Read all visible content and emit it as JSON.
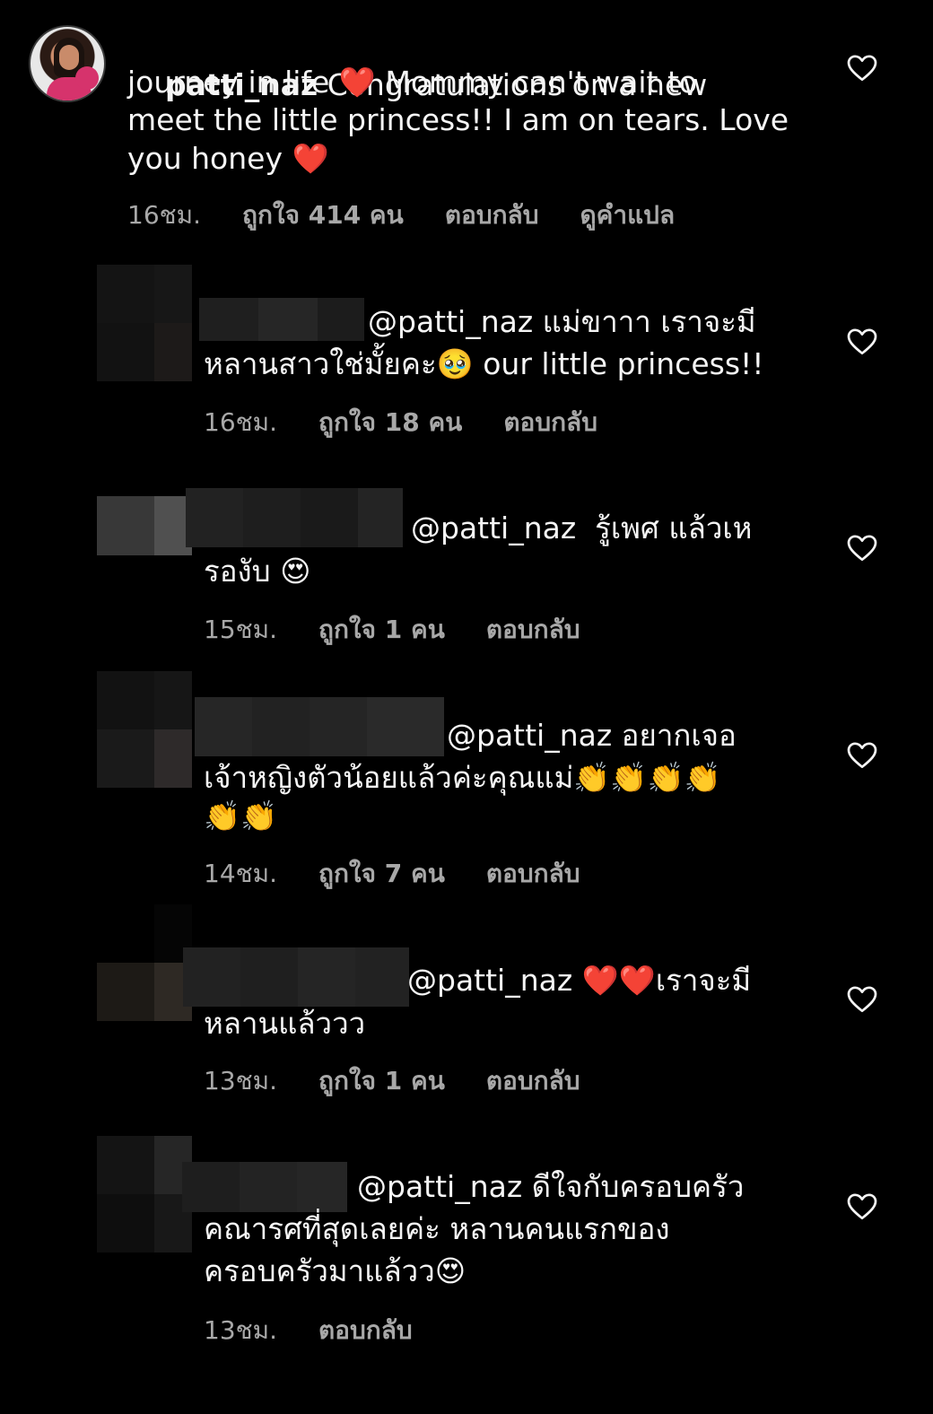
{
  "comments": [
    {
      "username": "patti_naz",
      "lines": [
        " Congratulations on a new",
        "journey in life ❤️ Mommy can't wait to",
        "meet the little princess!! I am on tears. Love",
        "you honey ❤️"
      ],
      "time": "16ชม.",
      "likes": "ถูกใจ 414 คน",
      "reply": "ตอบกลับ",
      "translate": "ดูคำแปล"
    },
    {
      "lines": [
        "@patti_naz แม่ขาาา เราจะมี",
        "หลานสาวใช่มั้ยคะ🥹 our little princess!!"
      ],
      "time": "16ชม.",
      "likes": "ถูกใจ 18 คน",
      "reply": "ตอบกลับ"
    },
    {
      "lines": [
        "@patti_naz  รู้เพศ แล้วเห",
        "รองับ 😍"
      ],
      "time": "15ชม.",
      "likes": "ถูกใจ 1 คน",
      "reply": "ตอบกลับ"
    },
    {
      "lines": [
        "@patti_naz อยากเจอ",
        "เจ้าหญิงตัวน้อยแล้วค่ะคุณแม่👏👏👏👏",
        "👏👏"
      ],
      "time": "14ชม.",
      "likes": "ถูกใจ 7 คน",
      "reply": "ตอบกลับ"
    },
    {
      "lines": [
        "@patti_naz ❤️❤️เราจะมี",
        "หลานแล้ววว"
      ],
      "time": "13ชม.",
      "likes": "ถูกใจ 1 คน",
      "reply": "ตอบกลับ"
    },
    {
      "lines": [
        "@patti_naz ดีใจกับครอบครัว",
        "คณารศที่สุดเลยค่ะ หลานคนแรกของ",
        "ครอบครัวมาแล้วว😍"
      ],
      "time": "13ชม.",
      "reply": "ตอบกลับ"
    }
  ],
  "icons": {
    "like": "heart-outline-icon"
  },
  "colors": {
    "background": "#000000",
    "text": "#f5f5f5",
    "meta": "#a8a8a8",
    "heart_stroke": "#f5f5f5"
  }
}
